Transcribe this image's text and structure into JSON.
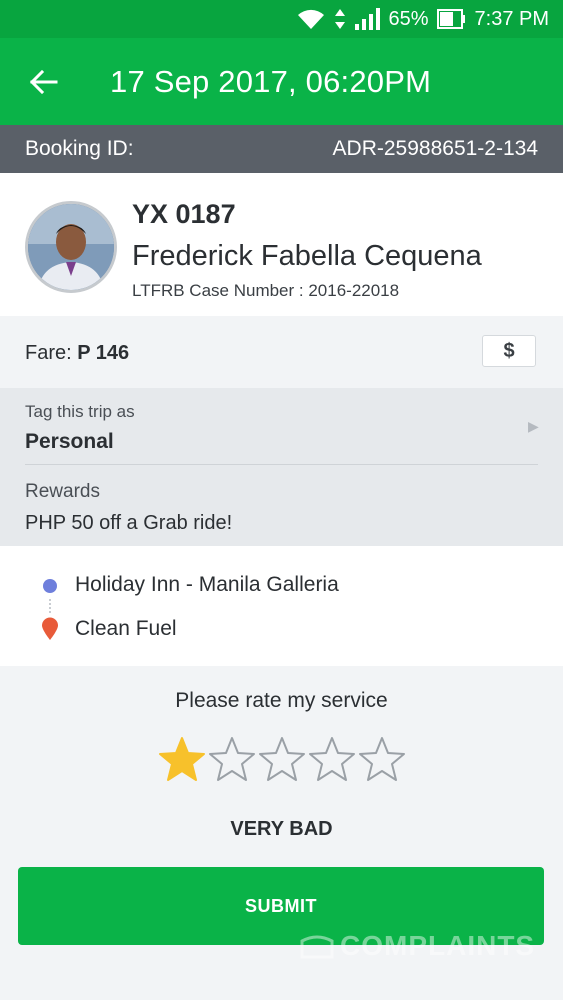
{
  "status_bar": {
    "battery_percent": "65%",
    "time": "7:37 PM"
  },
  "app_bar": {
    "title": "17 Sep 2017, 06:20PM",
    "back_icon": "arrow-left-icon"
  },
  "booking": {
    "label": "Booking ID:",
    "value": "ADR-25988651-2-134"
  },
  "driver": {
    "plate": "YX 0187",
    "name": "Frederick Fabella Cequena",
    "case_number": "LTFRB Case Number : 2016-22018"
  },
  "fare": {
    "label": "Fare: ",
    "amount": "P 146",
    "cash_icon": "$"
  },
  "tag": {
    "label": "Tag this trip as",
    "value": "Personal"
  },
  "rewards": {
    "label": "Rewards",
    "value": "PHP 50 off a Grab ride!"
  },
  "route": {
    "pickup": "Holiday Inn - Manila Galleria",
    "dropoff": "Clean Fuel"
  },
  "rating": {
    "prompt": "Please rate my service",
    "stars_total": 5,
    "stars_selected": 1,
    "label": "VERY BAD"
  },
  "submit_label": "SUBMIT",
  "watermark": "COMPLAINTS",
  "colors": {
    "status_bar": "#08a53f",
    "app_bar": "#0ab348",
    "booking_bar": "#5a6068",
    "star_filled": "#f7c12b",
    "pickup_dot": "#6e7fdc",
    "dropoff_pin": "#e85b3a"
  }
}
